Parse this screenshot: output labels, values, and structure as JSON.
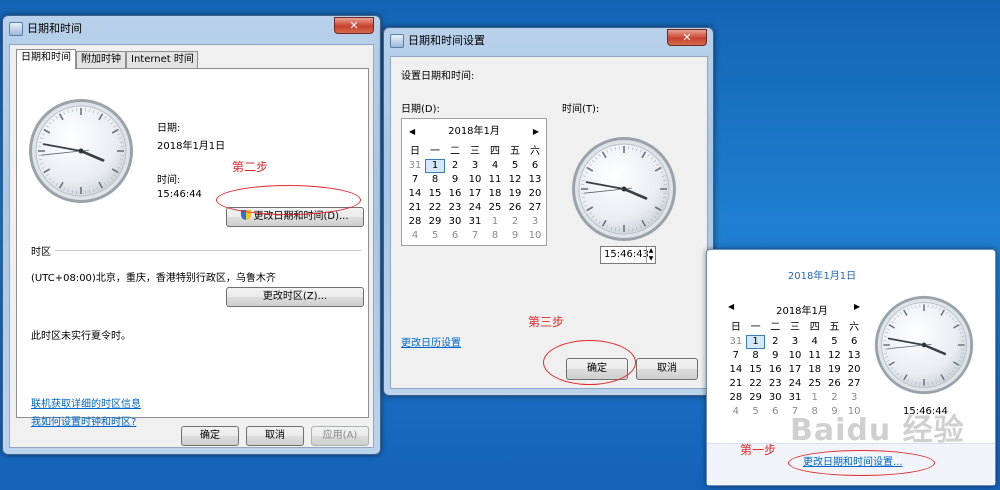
{
  "win1": {
    "title": "日期和时间",
    "close": "✕",
    "tabs": [
      "日期和时间",
      "附加时钟",
      "Internet 时间"
    ],
    "date_label": "日期:",
    "date_value": "2018年1月1日",
    "time_label": "时间:",
    "time_value": "15:46:44",
    "change_datetime_btn": "更改日期和时间(D)...",
    "timezone_header": "时区",
    "timezone_value": "(UTC+08:00)北京，重庆，香港特别行政区，乌鲁木齐",
    "change_timezone_btn": "更改时区(Z)...",
    "dst_note": "此时区未实行夏令时。",
    "link_tz_info": "联机获取详细的时区信息",
    "link_howto": "我如何设置时钟和时区?",
    "ok": "确定",
    "cancel": "取消",
    "apply": "应用(A)"
  },
  "win2": {
    "title": "日期和时间设置",
    "close": "✕",
    "heading": "设置日期和时间:",
    "date_label": "日期(D):",
    "time_label": "时间(T):",
    "month_title": "2018年1月",
    "time_input": "15:46:43",
    "link_calendar": "更改日历设置",
    "ok": "确定",
    "cancel": "取消"
  },
  "flyout": {
    "date_title": "2018年1月1日",
    "month_title": "2018年1月",
    "time": "15:46:44",
    "link_change": "更改日期和时间设置..."
  },
  "weekdays": [
    "日",
    "一",
    "二",
    "三",
    "四",
    "五",
    "六"
  ],
  "calendar_weeks": [
    [
      "31",
      "1",
      "2",
      "3",
      "4",
      "5",
      "6"
    ],
    [
      "7",
      "8",
      "9",
      "10",
      "11",
      "12",
      "13"
    ],
    [
      "14",
      "15",
      "16",
      "17",
      "18",
      "19",
      "20"
    ],
    [
      "21",
      "22",
      "23",
      "24",
      "25",
      "26",
      "27"
    ],
    [
      "28",
      "29",
      "30",
      "31",
      "1",
      "2",
      "3"
    ],
    [
      "4",
      "5",
      "6",
      "7",
      "8",
      "9",
      "10"
    ]
  ],
  "annotations": {
    "step1": "第一步",
    "step2": "第二步",
    "step3": "第三步"
  },
  "watermark": "Baidu 经验",
  "colors": {
    "desktop": "#1a6fc4",
    "annotation_red": "#e0292b",
    "link_blue": "#0066cc"
  },
  "clock_time": {
    "hour": 15,
    "minute": 46,
    "second": 44
  }
}
